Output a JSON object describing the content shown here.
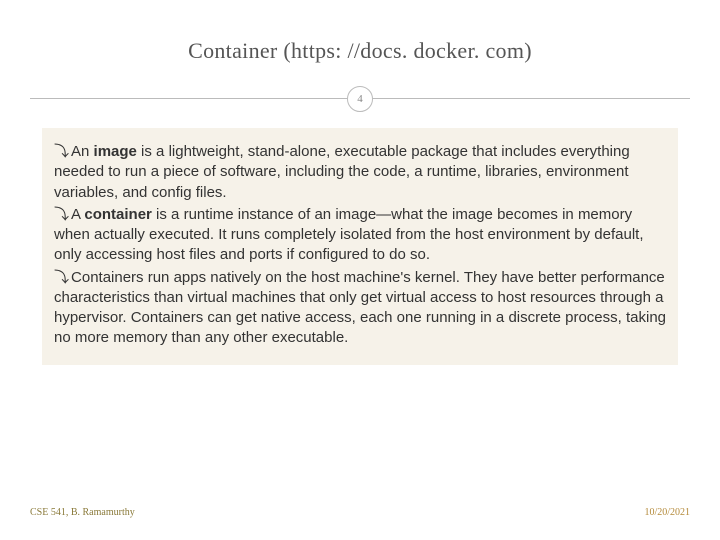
{
  "title": "Container (https: //docs. docker. com)",
  "page_number": "4",
  "bullets": [
    {
      "pre": "An ",
      "strong": "image",
      "post": " is a lightweight, stand-alone, executable package that includes everything needed to run a piece of software, including the code, a runtime, libraries, environment variables, and config files."
    },
    {
      "pre": "A ",
      "strong": "container",
      "post": " is a runtime instance of an image—what the image becomes in memory when actually executed. It runs completely isolated from the host environment by default, only accessing host files and ports if configured to do so."
    },
    {
      "pre": "",
      "strong": "",
      "post": "Containers run apps natively on the host machine's kernel. They have better performance characteristics than virtual machines that only get virtual access to host resources through a hypervisor. Containers can get native access, each one running in a discrete process, taking no more memory than any other executable."
    }
  ],
  "footer_left": "CSE 541, B. Ramamurthy",
  "footer_right": "10/20/2021",
  "bullet_glyph": "⤵"
}
